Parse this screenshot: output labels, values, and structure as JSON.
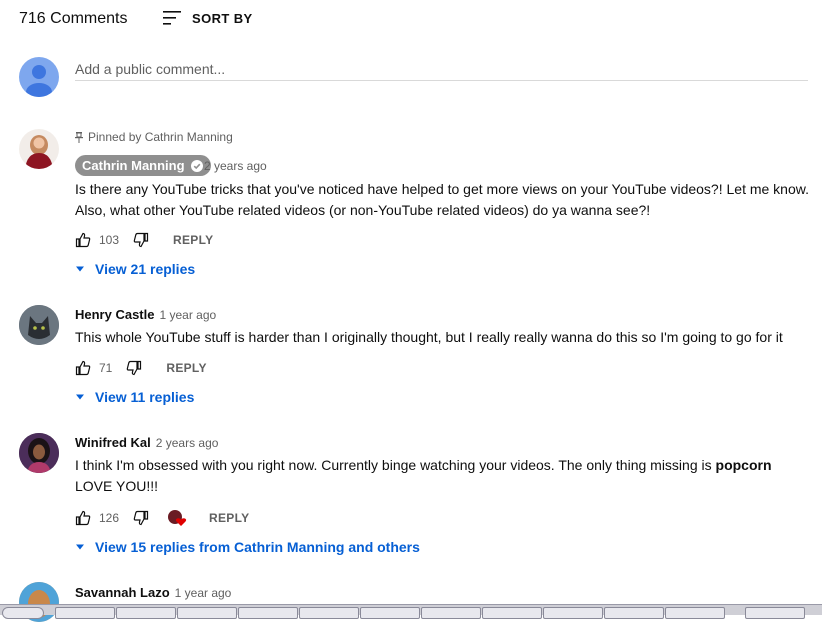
{
  "header": {
    "comment_count": "716 Comments",
    "sort_label": "SORT BY"
  },
  "add_comment": {
    "placeholder": "Add a public comment..."
  },
  "comments": [
    {
      "pinned_label": "Pinned by Cathrin Manning",
      "author": "Cathrin Manning",
      "verified": true,
      "time": "2 years ago",
      "text": "Is there any YouTube tricks that you've noticed have helped to get more views on your YouTube videos?! Let me know. Also, what other YouTube related videos (or non-YouTube related videos) do ya wanna see?!",
      "likes": "103",
      "reply_label": "REPLY",
      "replies_label": "View 21 replies"
    },
    {
      "author": "Henry Castle",
      "time": "1 year ago",
      "text": "This whole YouTube stuff is harder than I originally thought, but I really really wanna do this so I'm going to go for it",
      "likes": "71",
      "reply_label": "REPLY",
      "replies_label": "View 11 replies"
    },
    {
      "author": "Winifred Kal",
      "time": "2 years ago",
      "text_before": "I think I'm obsessed with you right now. Currently binge watching your videos. The only thing missing is ",
      "text_bold": "popcorn",
      "text_after": " LOVE YOU!!!",
      "likes": "126",
      "creator_heart": true,
      "reply_label": "REPLY",
      "replies_label": "View 15 replies from Cathrin Manning and others"
    },
    {
      "author": "Savannah Lazo",
      "time": "1 year ago"
    }
  ],
  "colors": {
    "link": "#065fd4",
    "meta": "#606060",
    "chip": "#8f8f8f",
    "heart": "#e00000"
  }
}
